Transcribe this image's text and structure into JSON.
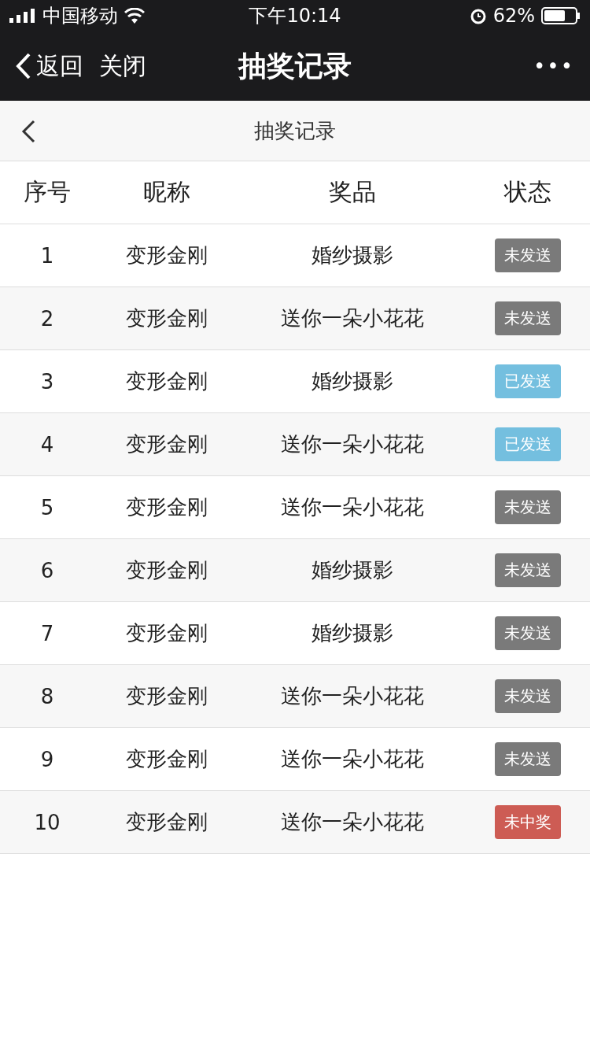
{
  "status_bar": {
    "carrier": "中国移动",
    "time": "下午10:14",
    "battery": "62%"
  },
  "nav_bar": {
    "back": "返回",
    "close": "关闭",
    "title": "抽奖记录",
    "more": "•••"
  },
  "page_header": {
    "title": "抽奖记录"
  },
  "table": {
    "columns": [
      "序号",
      "昵称",
      "奖品",
      "状态"
    ],
    "rows": [
      {
        "cells": [
          "1",
          "变形金刚",
          "婚纱摄影"
        ],
        "status": "未发送",
        "color": "#7a7a7a"
      },
      {
        "cells": [
          "2",
          "变形金刚",
          "送你一朵小花花"
        ],
        "status": "未发送",
        "color": "#7a7a7a"
      },
      {
        "cells": [
          "3",
          "变形金刚",
          "婚纱摄影"
        ],
        "status": "已发送",
        "color": "#74bfdf"
      },
      {
        "cells": [
          "4",
          "变形金刚",
          "送你一朵小花花"
        ],
        "status": "已发送",
        "color": "#74bfdf"
      },
      {
        "cells": [
          "5",
          "变形金刚",
          "送你一朵小花花"
        ],
        "status": "未发送",
        "color": "#7a7a7a"
      },
      {
        "cells": [
          "6",
          "变形金刚",
          "婚纱摄影"
        ],
        "status": "未发送",
        "color": "#7a7a7a"
      },
      {
        "cells": [
          "7",
          "变形金刚",
          "婚纱摄影"
        ],
        "status": "未发送",
        "color": "#7a7a7a"
      },
      {
        "cells": [
          "8",
          "变形金刚",
          "送你一朵小花花"
        ],
        "status": "未发送",
        "color": "#7a7a7a"
      },
      {
        "cells": [
          "9",
          "变形金刚",
          "送你一朵小花花"
        ],
        "status": "未发送",
        "color": "#7a7a7a"
      },
      {
        "cells": [
          "10",
          "变形金刚",
          "送你一朵小花花"
        ],
        "status": "未中奖",
        "color": "#cd5c54"
      }
    ]
  }
}
